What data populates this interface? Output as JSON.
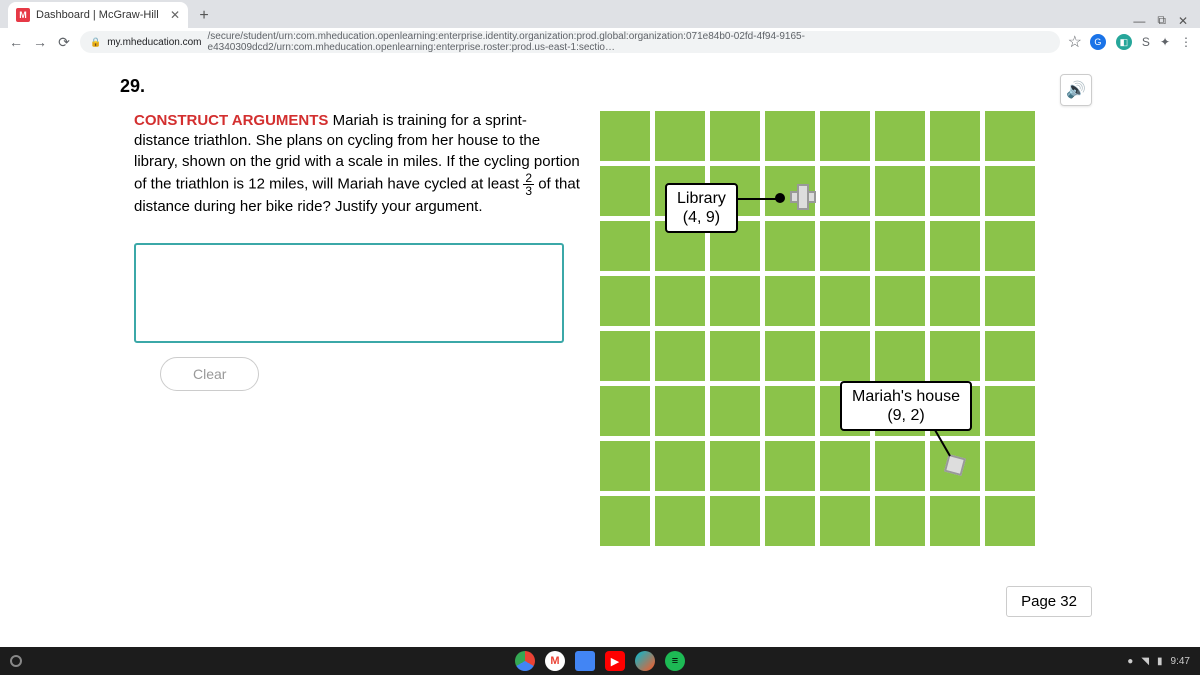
{
  "browser": {
    "tab_title": "Dashboard | McGraw-Hill",
    "favicon_letter": "M",
    "url_domain": "my.mheducation.com",
    "url_path": "/secure/student/urn:com.mheducation.openlearning:enterprise.identity.organization:prod.global:organization:071e84b0-02fd-4f94-9165-e4340309dcd2/urn:com.mheducation.openlearning:enterprise.roster:prod.us-east-1:sectio…",
    "s_icon": "S"
  },
  "question": {
    "number": "29.",
    "heading": "CONSTRUCT ARGUMENTS",
    "text_before_fraction": " Mariah is training for a sprint-distance triathlon. She plans on cycling from her house to the library, shown on the grid with a scale in miles. If the cycling portion of the triathlon is 12 miles, will Mariah have cycled at least ",
    "fraction_num": "2",
    "fraction_den": "3",
    "text_after_fraction": " of that distance during her bike ride? Justify your argument."
  },
  "buttons": {
    "clear": "Clear"
  },
  "grid": {
    "library_label": "Library",
    "library_coord": "(4, 9)",
    "house_label": "Mariah's house",
    "house_coord": "(9, 2)"
  },
  "page_label": "Page 32",
  "taskbar": {
    "time": "9:47"
  }
}
